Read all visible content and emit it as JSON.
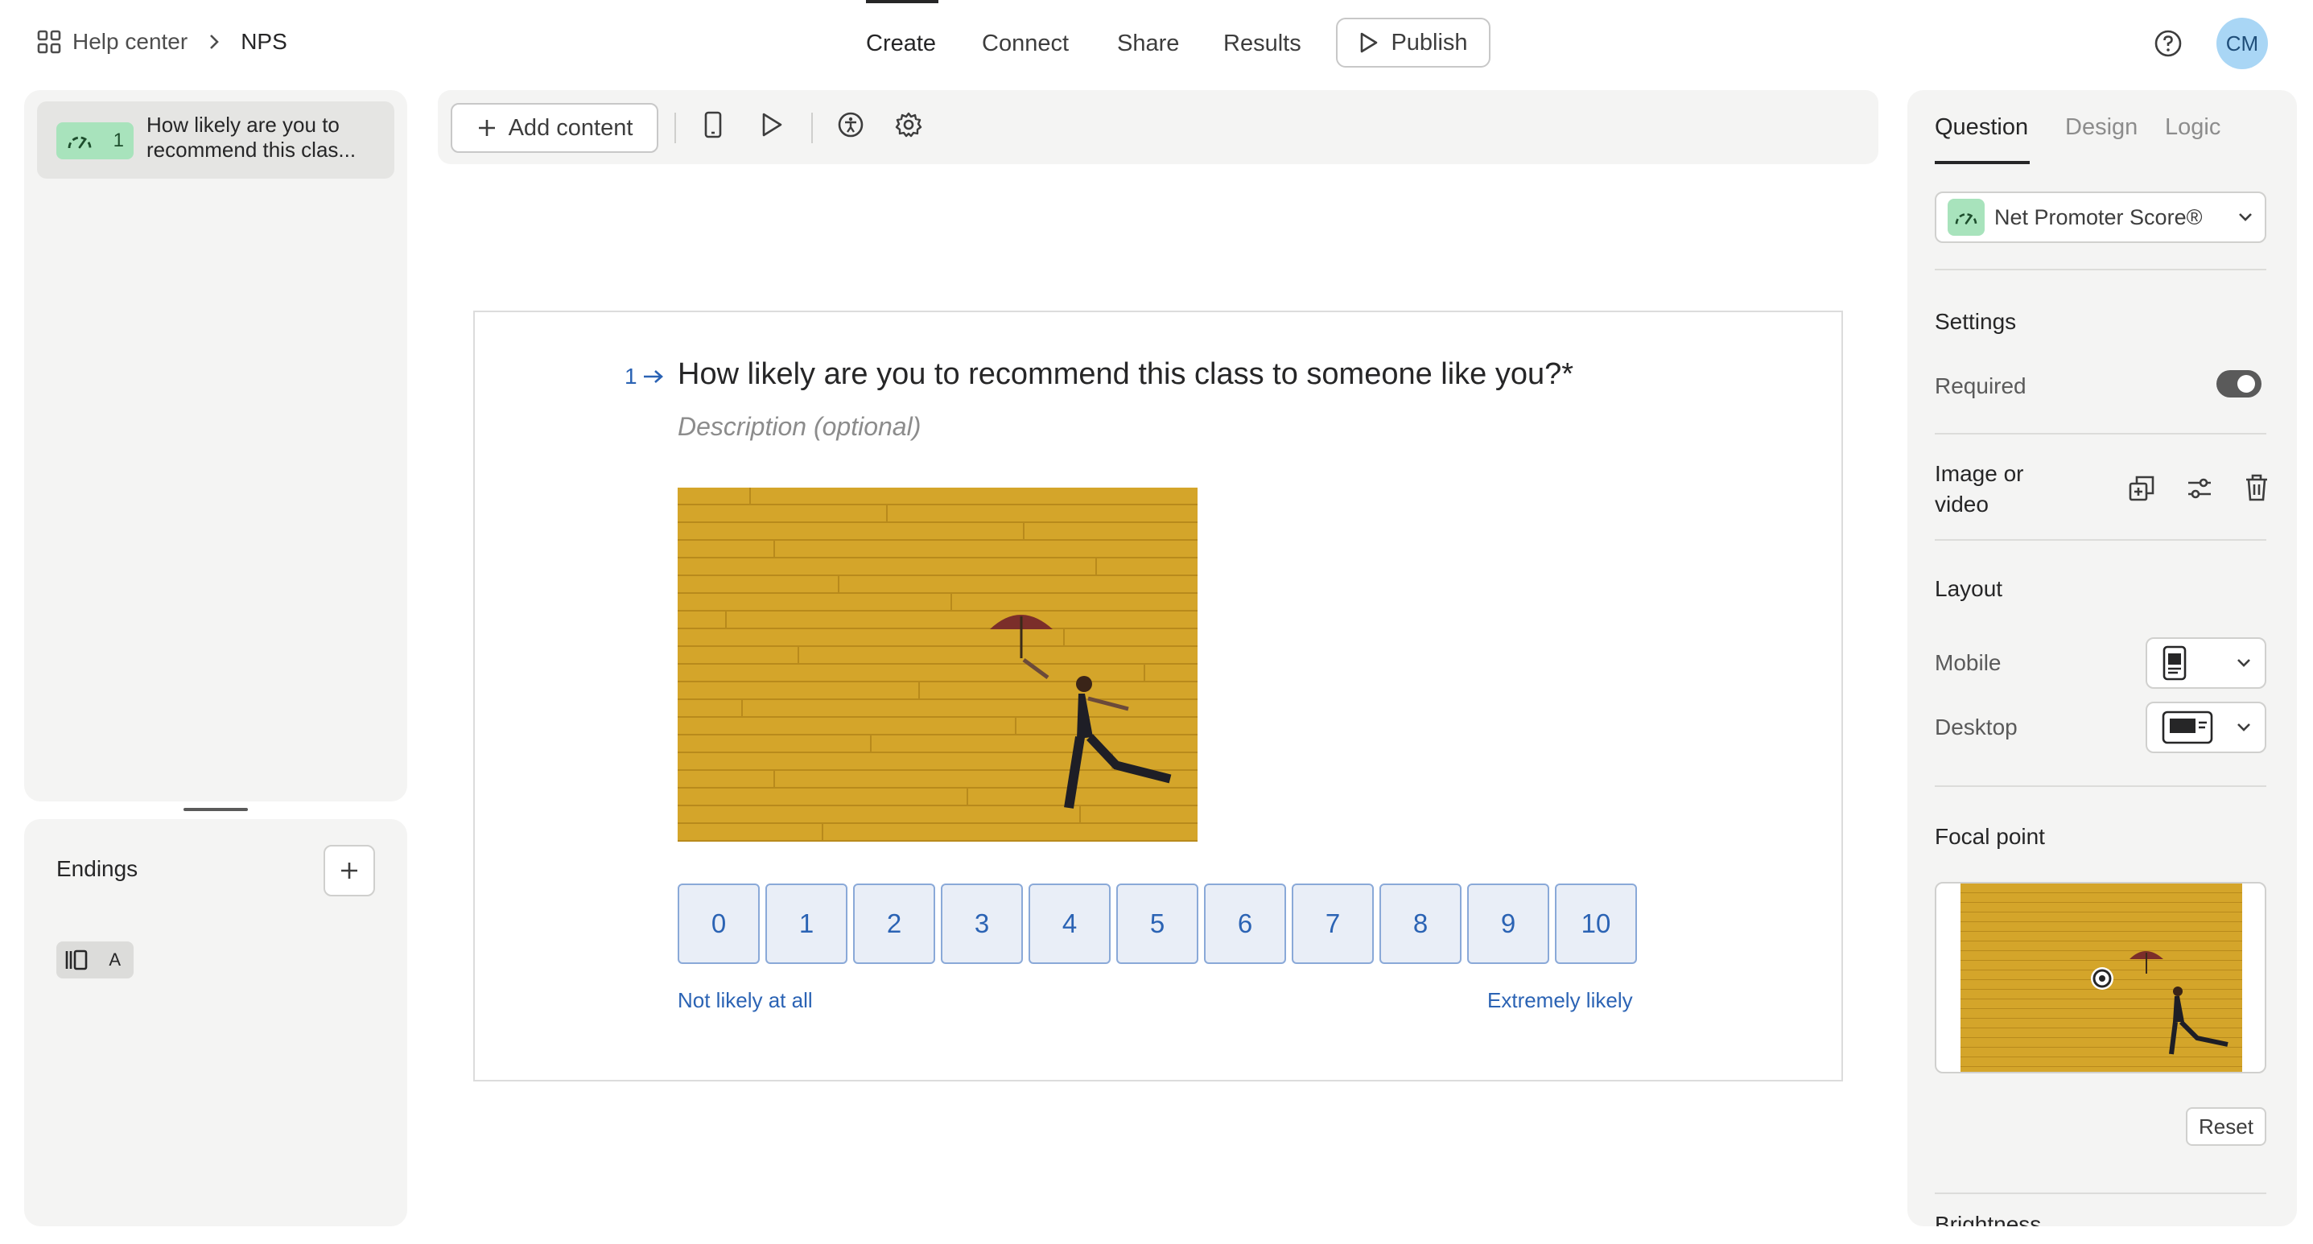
{
  "breadcrumb": {
    "home": "Help center",
    "current": "NPS"
  },
  "nav": {
    "tabs": [
      "Create",
      "Connect",
      "Share",
      "Results"
    ],
    "active": "Create",
    "publish": "Publish"
  },
  "user": {
    "initials": "CM"
  },
  "questions": [
    {
      "number": "1",
      "text": "How likely are you to recommend this clas..."
    }
  ],
  "endings": {
    "title": "Endings",
    "items": [
      {
        "label": "A"
      }
    ]
  },
  "toolbar": {
    "add_content": "Add content"
  },
  "question": {
    "number": "1",
    "title": "How likely are you to recommend this class to someone like you?*",
    "description_placeholder": "Description (optional)",
    "scale": [
      "0",
      "1",
      "2",
      "3",
      "4",
      "5",
      "6",
      "7",
      "8",
      "9",
      "10"
    ],
    "low_label": "Not likely at all",
    "high_label": "Extremely likely"
  },
  "panel": {
    "tabs": [
      "Question",
      "Design",
      "Logic"
    ],
    "active_tab": "Question",
    "question_type": "Net Promoter Score®",
    "settings_title": "Settings",
    "required_label": "Required",
    "required_on": true,
    "media_label": "Image or video",
    "layout_title": "Layout",
    "mobile_label": "Mobile",
    "desktop_label": "Desktop",
    "focal_title": "Focal point",
    "reset_label": "Reset",
    "brightness_title": "Brightness"
  },
  "colors": {
    "accent": "#2b63b4",
    "nps_green": "#a8e3bc",
    "photo_yellow": "#d6a62a"
  }
}
